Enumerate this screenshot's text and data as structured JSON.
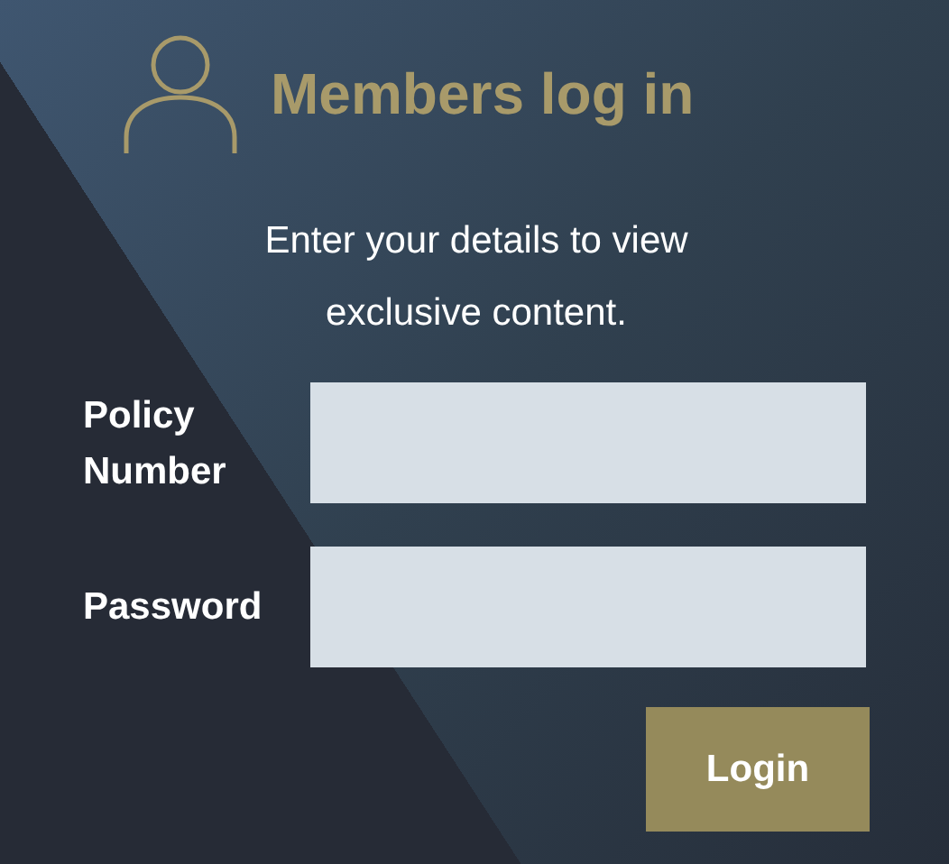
{
  "title": "Members log in",
  "intro": "Enter your details to view exclusive content.",
  "fields": [
    {
      "label": "Policy Number"
    },
    {
      "label": "Password"
    }
  ],
  "button": "Login"
}
